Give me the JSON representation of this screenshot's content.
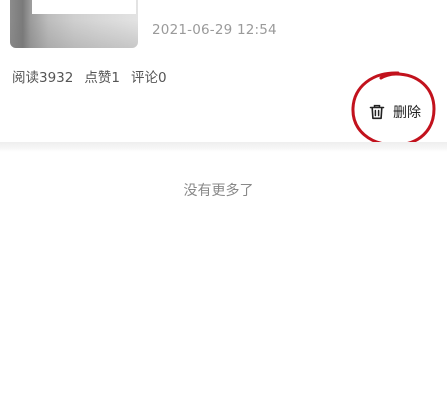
{
  "post": {
    "date": "2021-06-29 12:54",
    "stats": {
      "reads": "阅读3932",
      "likes": "点赞1",
      "comments": "评论0"
    },
    "delete_label": "删除",
    "delete_icon": "trash-icon"
  },
  "list": {
    "end_text": "没有更多了"
  },
  "colors": {
    "annotation": "#c2121d",
    "secondary_text": "#9a9a9a",
    "body_text": "#555555"
  }
}
